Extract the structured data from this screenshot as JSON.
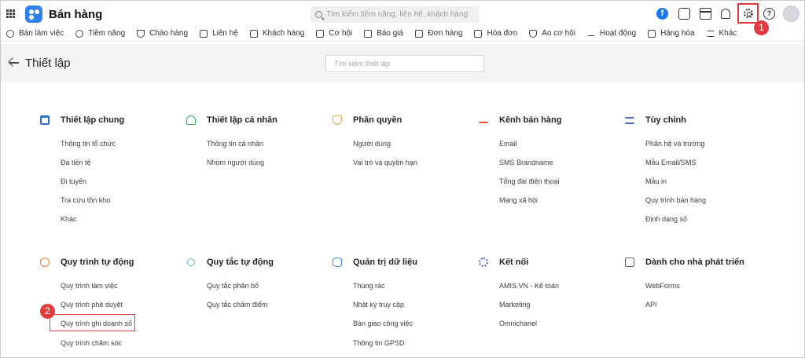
{
  "header": {
    "app_title": "Bán hàng",
    "search_placeholder": "Tìm kiếm tiềm năng, liên hệ, khách hàng",
    "facebook_glyph": "f",
    "help_glyph": "?"
  },
  "nav": {
    "items": [
      {
        "label": "Bàn làm việc",
        "icon": "desk-icon"
      },
      {
        "label": "Tiềm năng",
        "icon": "person-circle-icon"
      },
      {
        "label": "Chào hàng",
        "icon": "magnet-icon"
      },
      {
        "label": "Liên hệ",
        "icon": "contact-icon"
      },
      {
        "label": "Khách hàng",
        "icon": "building-icon"
      },
      {
        "label": "Cơ hội",
        "icon": "wallet-icon"
      },
      {
        "label": "Báo giá",
        "icon": "document-icon"
      },
      {
        "label": "Đơn hàng",
        "icon": "cart-icon"
      },
      {
        "label": "Hóa đơn",
        "icon": "invoice-icon"
      },
      {
        "label": "Ao cơ hội",
        "icon": "funnel-icon"
      },
      {
        "label": "Hoạt động",
        "icon": "activity-icon"
      },
      {
        "label": "Hàng hóa",
        "icon": "box-icon"
      },
      {
        "label": "Khác",
        "icon": "menu-icon"
      }
    ]
  },
  "page": {
    "title": "Thiết lập",
    "search_placeholder": "Tìm kiếm thiết lập"
  },
  "annotations": {
    "badge_1": "1",
    "badge_2": "2"
  },
  "sections": [
    {
      "title": "Thiết lập chung",
      "icon_color": "#2f6fd6",
      "links": [
        "Thông tin tổ chức",
        "Đa tiền tệ",
        "Đi tuyến",
        "Tra cứu tồn kho",
        "Khác"
      ]
    },
    {
      "title": "Thiết lập cá nhân",
      "icon_color": "#27ae60",
      "links": [
        "Thông tin cá nhân",
        "Nhóm người dùng"
      ]
    },
    {
      "title": "Phân quyền",
      "icon_color": "#f2a93b",
      "links": [
        "Người dùng",
        "Vai trò và quyền hạn"
      ]
    },
    {
      "title": "Kênh bán hàng",
      "icon_color": "#e74c3c",
      "links": [
        "Email",
        "SMS Brandname",
        "Tổng đài điện thoại",
        "Mạng xã hội"
      ]
    },
    {
      "title": "Tùy chỉnh",
      "icon_color": "#4a6fd6",
      "links": [
        "Phân hệ và trường",
        "Mẫu Email/SMS",
        "Mẫu in",
        "Quy trình bán hàng",
        "Định dạng số"
      ]
    },
    {
      "title": "Quy trình tự động",
      "icon_color": "#f07b3f",
      "links": [
        "Quy trình làm việc",
        "Quy trình phê duyệt",
        "Quy trình ghi doanh số",
        "Quy trình chăm sóc"
      ]
    },
    {
      "title": "Quy tắc tự động",
      "icon_color": "#1fa8c9",
      "links": [
        "Quy tắc phân bổ",
        "Quy tắc chấm điểm"
      ]
    },
    {
      "title": "Quản trị dữ liệu",
      "icon_color": "#2f80ed",
      "links": [
        "Thùng rác",
        "Nhật ký truy cập",
        "Bàn giao công việc",
        "Thông tin GPSD"
      ]
    },
    {
      "title": "Kết nối",
      "icon_color": "#3d5bd6",
      "links": [
        "AMIS.VN - Kế toán",
        "Marketing",
        "Omnichanel"
      ]
    },
    {
      "title": "Dành cho nhà phát triển",
      "icon_color": "#5a6470",
      "links": [
        "WebForms",
        "API"
      ]
    }
  ]
}
